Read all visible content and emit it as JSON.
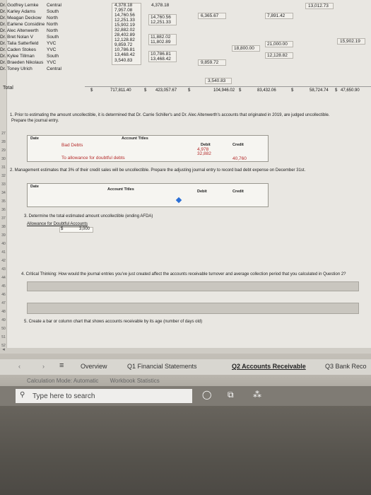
{
  "sheet": {
    "names": [
      {
        "name": "Dr. Godfrey Lemke",
        "region": "Central"
      },
      {
        "name": "Dr. Karley Adams",
        "region": "South"
      },
      {
        "name": "Dr. Meagan Deckow",
        "region": "North"
      },
      {
        "name": "Dr. Earlene Considine",
        "region": "North"
      },
      {
        "name": "Dr. Alec Altenwerth",
        "region": "North"
      },
      {
        "name": "Dr. Bret Nolan V",
        "region": "South"
      },
      {
        "name": "Dr. Talia Satterfield",
        "region": "YVC"
      },
      {
        "name": "Dr. Caden Stokes",
        "region": "YVC"
      },
      {
        "name": "Dr. Kylee Tillman",
        "region": "South"
      },
      {
        "name": "Dr. Braeden Nikolaus",
        "region": "YVC"
      },
      {
        "name": "Dr. Toney Ulrich",
        "region": "Central"
      }
    ],
    "col1": [
      "4,378.18",
      "7,957.08",
      "14,760.56",
      "12,251.33",
      "15,902.19",
      "32,882.02",
      "28,402.89",
      "12,128.82",
      "9,859.72",
      "10,786.81",
      "13,468.42",
      "3,540.83"
    ],
    "col2_top": "4,378.18",
    "col3": [
      "14,760.56",
      "12,251.33"
    ],
    "col4": [
      "11,882.02",
      "11,802.89"
    ],
    "col5_a": "10,786.81",
    "col5_b": "13,468.42",
    "col6_a": "6,365.67",
    "col6_b": "9,859.72",
    "col7_a": "18,800.00",
    "col8_a": "7,891.42",
    "col8_b": "21,000.00",
    "col8_c": "12,128.82",
    "col9_a": "13,012.73",
    "col9_b": "15,902.19",
    "col_extra": "3,540.83",
    "total_label": "Total",
    "totals": [
      "$",
      "717,811.40",
      "$",
      "423,057.67",
      "$",
      "104,946.02",
      "$",
      "83,432.06",
      "$",
      "58,724.74",
      "$",
      "47,650.90"
    ]
  },
  "q1": {
    "text": "1. Prior to estimating the amount uncollectible, it is determined that Dr. Carrie Schiller's and Dr. Alec Altenwerth's accounts that originated in 2019, are judged uncollectible.",
    "sub": "Prepare the journal entry.",
    "headers": {
      "date": "Date",
      "account": "Account Titles",
      "debit": "Debit",
      "credit": "Credit"
    },
    "rows": [
      {
        "account": "Bad Debts",
        "debit": "4,978",
        "debit2": "32,882",
        "credit": ""
      },
      {
        "account": "To allowance for doubtful debts",
        "debit": "",
        "credit": "40,760"
      }
    ]
  },
  "q2": {
    "text": "2. Management estimates that 3% of their credit sales will be uncollectible. Prepare the adjusting journal entry to record bad debt expense on December 31st.",
    "headers": {
      "date": "Date",
      "account": "Account Titles",
      "debit": "Debit",
      "credit": "Credit"
    }
  },
  "q3": {
    "text": "3. Determine the total estimated amount uncollectible (ending AFDA)",
    "label": "Allowance for Doubtful Accounts",
    "currency": "$",
    "value": "3,000"
  },
  "q4": {
    "text": "4. Critical Thinking: How would the journal entries you've just created affect the accounts receivable turnover and average collection period that you calculated in Question 2?"
  },
  "q5": {
    "text": "5. Create a bar or column chart that shows accounts receivable by its age (number of days old)"
  },
  "tabs": {
    "overview": "Overview",
    "q1": "Q1 Financial Statements",
    "q2": "Q2 Accounts Receivable",
    "q3": "Q3 Bank Reco"
  },
  "status": {
    "calc": "Calculation Mode: Automatic",
    "stats": "Workbook Statistics"
  },
  "taskbar": {
    "search_placeholder": "Type here to search"
  },
  "row_numbers": [
    "27",
    "28",
    "29",
    "30",
    "31",
    "32",
    "33",
    "34",
    "35",
    "36",
    "37",
    "38",
    "39",
    "40",
    "41",
    "42",
    "43",
    "44",
    "45",
    "46",
    "47",
    "48",
    "49",
    "50",
    "51",
    "52"
  ]
}
